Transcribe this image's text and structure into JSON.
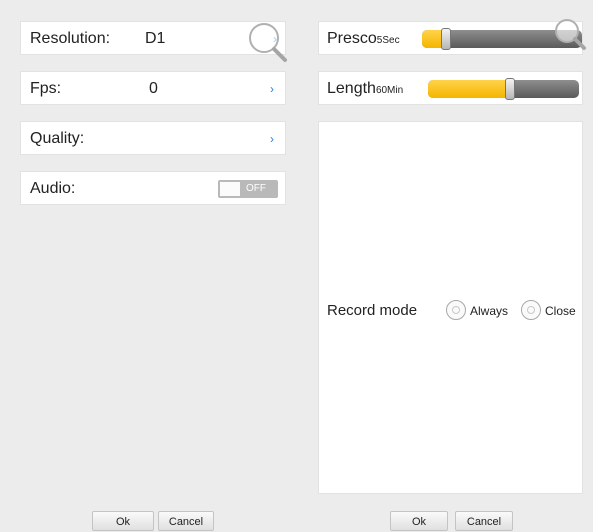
{
  "left": {
    "resolution": {
      "label": "Resolution:",
      "value": "D1"
    },
    "fps": {
      "label": "Fps:",
      "value": "0"
    },
    "quality": {
      "label": "Quality:"
    },
    "audio": {
      "label": "Audio:",
      "toggle_text": "OFF",
      "on": false
    },
    "ok_label": "Ok",
    "cancel_label": "Cancel"
  },
  "right": {
    "presco": {
      "label": "Presco",
      "unit": "5Sec",
      "level_percent": 12
    },
    "length": {
      "label": "Length",
      "unit": "60Min",
      "level_percent": 52
    },
    "record_mode": {
      "label": "Record mode",
      "options": [
        "Always",
        "Close"
      ]
    },
    "ok_label": "Ok",
    "cancel_label": "Cancel"
  },
  "icons": {
    "search": "magnifier-icon",
    "chevron": "chevron-right-icon",
    "radio": "radio-button"
  },
  "colors": {
    "slider_fill": "#f5b500",
    "chevron": "#2e7bd6",
    "background": "#ececec"
  }
}
